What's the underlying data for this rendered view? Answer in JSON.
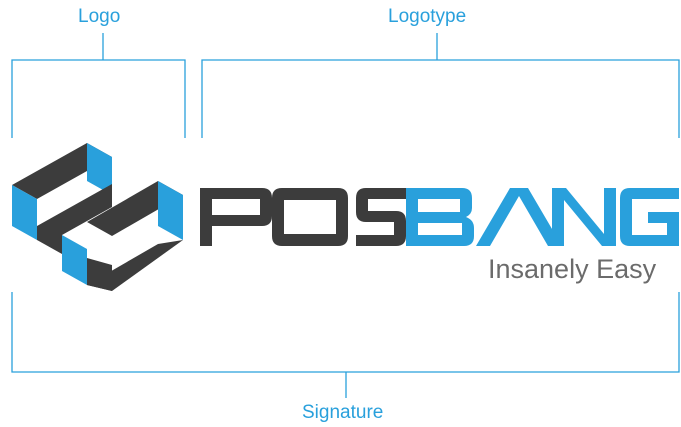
{
  "callouts": {
    "logo": "Logo",
    "logotype": "Logotype",
    "signature": "Signature"
  },
  "brand": {
    "wordmark_part1": "POS",
    "wordmark_part2": "BANG",
    "tagline": "Insanely Easy"
  },
  "colors": {
    "accent_blue": "#29a0dc",
    "dark_gray": "#3c3c3c",
    "tagline_gray": "#6b6b6b",
    "bracket_line": "#29a0dc"
  }
}
